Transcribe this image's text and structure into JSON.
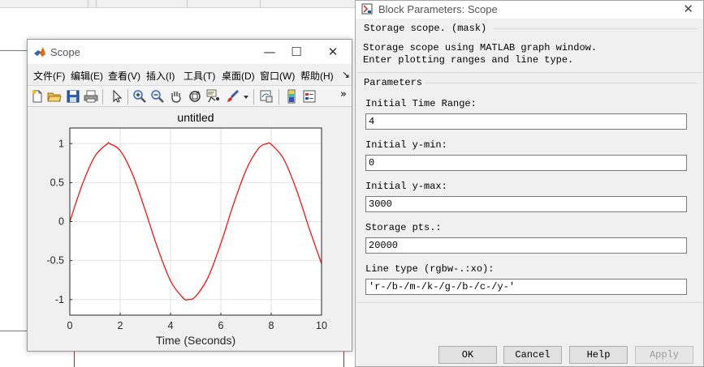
{
  "scope_window": {
    "title": "Scope",
    "menu": [
      "文件(F)",
      "编辑(E)",
      "查看(V)",
      "插入(I)",
      "工具(T)",
      "桌面(D)",
      "窗口(W)",
      "帮助(H)"
    ],
    "menu_overflow": "↘",
    "toolbar_overflow": "»",
    "toolbar_icons": [
      "new-figure-icon",
      "open-file-icon",
      "save-icon",
      "print-icon",
      "pointer-icon",
      "zoom-in-icon",
      "zoom-out-icon",
      "pan-hand-icon",
      "rotate-3d-icon",
      "data-cursor-icon",
      "brush-icon",
      "dropdown-arrow-icon",
      "link-plot-icon",
      "colorbar-icon",
      "legend-icon"
    ],
    "window_controls": {
      "minimize": "—",
      "maximize": "☐",
      "close": "✕"
    }
  },
  "chart_data": {
    "type": "line",
    "title": "untitled",
    "xlabel": "Time (Seconds)",
    "ylabel": "",
    "xlim": [
      0,
      10
    ],
    "ylim": [
      -1.2,
      1.2
    ],
    "xticks": [
      0,
      2,
      4,
      6,
      8,
      10
    ],
    "yticks": [
      -1,
      -0.5,
      0,
      0.5,
      1
    ],
    "xtick_labels": [
      "0",
      "2",
      "4",
      "6",
      "8",
      "10"
    ],
    "ytick_labels": [
      "-1",
      "-0.5",
      "0",
      "0.5",
      "1"
    ],
    "grid": true,
    "series": [
      {
        "color": "#ff0000",
        "x": [
          0,
          0.5,
          1,
          1.5,
          1.57,
          2,
          2.5,
          3,
          3.14,
          3.5,
          4,
          4.5,
          4.71,
          5,
          5.5,
          6,
          6.28,
          6.5,
          7,
          7.5,
          7.85,
          8,
          8.5,
          9,
          9.42,
          9.5,
          10
        ],
        "y": [
          0,
          0.48,
          0.84,
          1.0,
          1.0,
          0.91,
          0.6,
          0.14,
          0,
          -0.35,
          -0.76,
          -0.98,
          -1.0,
          -0.96,
          -0.71,
          -0.28,
          0,
          0.22,
          0.66,
          0.94,
          1.0,
          0.99,
          0.8,
          0.41,
          0,
          -0.08,
          -0.54
        ]
      }
    ]
  },
  "dialog": {
    "title": "Block Parameters: Scope",
    "close": "✕",
    "mask_label": "Storage scope. (mask)",
    "description_line1": "Storage scope using MATLAB graph window.",
    "description_line2": "Enter plotting ranges and line type.",
    "parameters_label": "Parameters",
    "fields": [
      {
        "label": "Initial Time Range:",
        "value": "4"
      },
      {
        "label": "Initial y-min:",
        "value": "0"
      },
      {
        "label": "Initial y-max:",
        "value": "3000"
      },
      {
        "label": "Storage pts.:",
        "value": "20000"
      },
      {
        "label": "Line type (rgbw-.:xo):",
        "value": "'r-/b-/m-/k-/g-/b-/c-/y-'"
      }
    ],
    "buttons": {
      "ok": "OK",
      "cancel": "Cancel",
      "help": "Help",
      "apply": "Apply"
    }
  }
}
